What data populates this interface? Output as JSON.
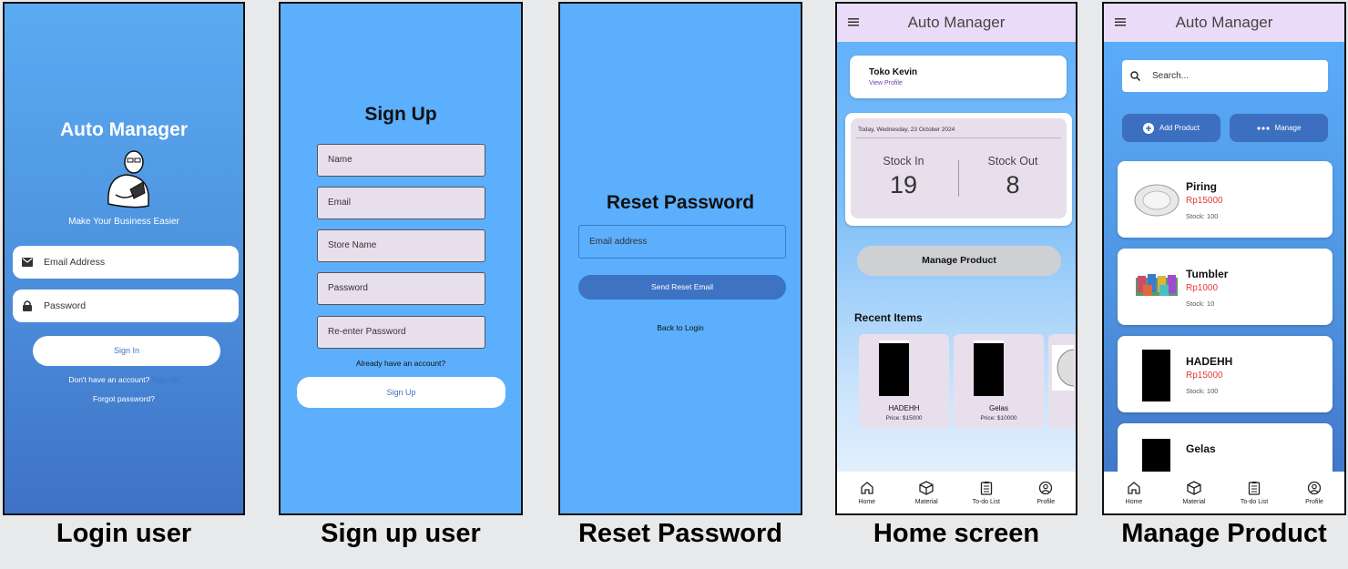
{
  "login": {
    "title": "Auto Manager",
    "tagline": "Make Your Business Easier",
    "email_placeholder": "Email Address",
    "password_placeholder": "Password",
    "signin_label": "Sign In",
    "no_account_text": "Don't have an account?",
    "signup_link": "Sign Up",
    "forgot_label": "Forgot password?",
    "caption": "Login user"
  },
  "signup": {
    "title": "Sign Up",
    "fields": [
      "Name",
      "Email",
      "Store Name",
      "Password",
      "Re-enter Password"
    ],
    "have_account_text": "Already have an account?",
    "signup_label": "Sign Up",
    "caption": "Sign up user"
  },
  "reset": {
    "title": "Reset Password",
    "email_placeholder": "Email address",
    "send_label": "Send Reset Email",
    "back_label": "Back to Login",
    "caption": "Reset Password"
  },
  "app": {
    "title": "Auto Manager",
    "nav": [
      "Home",
      "Material",
      "To-do List",
      "Profile"
    ]
  },
  "home": {
    "store_name": "Toko Kevin",
    "view_profile": "View Profile",
    "date": "Today, Wednesday, 23 October 2024",
    "stock_in_label": "Stock In",
    "stock_in_value": "19",
    "stock_out_label": "Stock Out",
    "stock_out_value": "8",
    "manage_label": "Manage Product",
    "recent_title": "Recent Items",
    "recent_items": [
      {
        "name": "HADEHH",
        "price": "Price: $15000"
      },
      {
        "name": "Gelas",
        "price": "Price: $10000"
      }
    ],
    "caption": "Home screen"
  },
  "manage": {
    "search_placeholder": "Search...",
    "add_label": "Add Product",
    "manage_label": "Manage",
    "products": [
      {
        "name": "Piring",
        "price": "Rp15000",
        "stock": "Stock: 100"
      },
      {
        "name": "Tumbler",
        "price": "Rp1000",
        "stock": "Stock: 10"
      },
      {
        "name": "HADEHH",
        "price": "Rp15000",
        "stock": "Stock: 100"
      },
      {
        "name": "Gelas",
        "price": "",
        "stock": ""
      }
    ],
    "caption": "Manage Product"
  },
  "colors": {
    "accent_blue": "#5caffd",
    "button_blue": "#3e72c3",
    "appbar": "#eadcf8",
    "price_red": "#e53935"
  }
}
